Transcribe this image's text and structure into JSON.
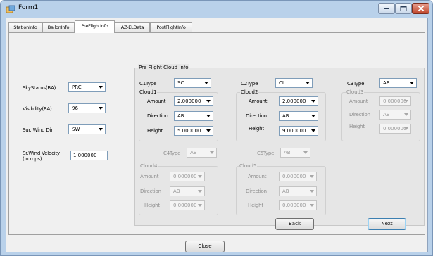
{
  "window": {
    "title": "Form1"
  },
  "tabs": [
    {
      "label": "StationInfo",
      "active": false
    },
    {
      "label": "BallonInfo",
      "active": false
    },
    {
      "label": "PreFlightInfo",
      "active": true
    },
    {
      "label": "AZ-ELData",
      "active": false
    },
    {
      "label": "PostFlightInfo",
      "active": false
    }
  ],
  "left": {
    "sky_status": {
      "label": "SkyStatus(BA)",
      "value": "PRC"
    },
    "visibility": {
      "label": "Visibility(BA)",
      "value": "96"
    },
    "wind_dir": {
      "label": "Sur. Wind Dir",
      "value": "SW"
    },
    "wind_velocity": {
      "label": "Sr.Wind Velocity (in mps)",
      "value": "1.000000"
    }
  },
  "cloud_info": {
    "title": "Pre Flight Cloud Info",
    "c1": {
      "type_label": "C1Type",
      "type": "SC",
      "group": "Cloud1",
      "amount_label": "Amount",
      "amount": "2.000000",
      "direction_label": "Direction",
      "direction": "AB",
      "height_label": "Height",
      "height": "5.000000"
    },
    "c2": {
      "type_label": "C2Type",
      "type": "CI",
      "group": "Cloud2",
      "amount_label": "Amount",
      "amount": "2.000000",
      "direction_label": "Direction",
      "direction": "AB",
      "height_label": "Height",
      "height": "9.000000"
    },
    "c3": {
      "type_label": "C3Type",
      "type": "AB",
      "group": "Cloud3",
      "amount_label": "Amount",
      "amount": "0.000000",
      "direction_label": "Direction",
      "direction": "AB",
      "height_label": "Height",
      "height": "0.000000"
    },
    "c4": {
      "type_label": "C4Type",
      "type": "AB",
      "group": "Cloud4",
      "amount_label": "Amount",
      "amount": "0.000000",
      "direction_label": "Direction",
      "direction": "AB",
      "height_label": "Height",
      "height": "0.000000"
    },
    "c5": {
      "type_label": "C5Type",
      "type": "AB",
      "group": "Cloud5",
      "amount_label": "Amount",
      "amount": "0.000000",
      "direction_label": "Direction",
      "direction": "AB",
      "height_label": "Height",
      "height": "0.000000"
    }
  },
  "buttons": {
    "back": "Back",
    "next": "Next",
    "close": "Close"
  },
  "colors": {
    "title_bar": "#b9d1ea",
    "face": "#f0f0f0",
    "close_button": "#c0462c"
  }
}
